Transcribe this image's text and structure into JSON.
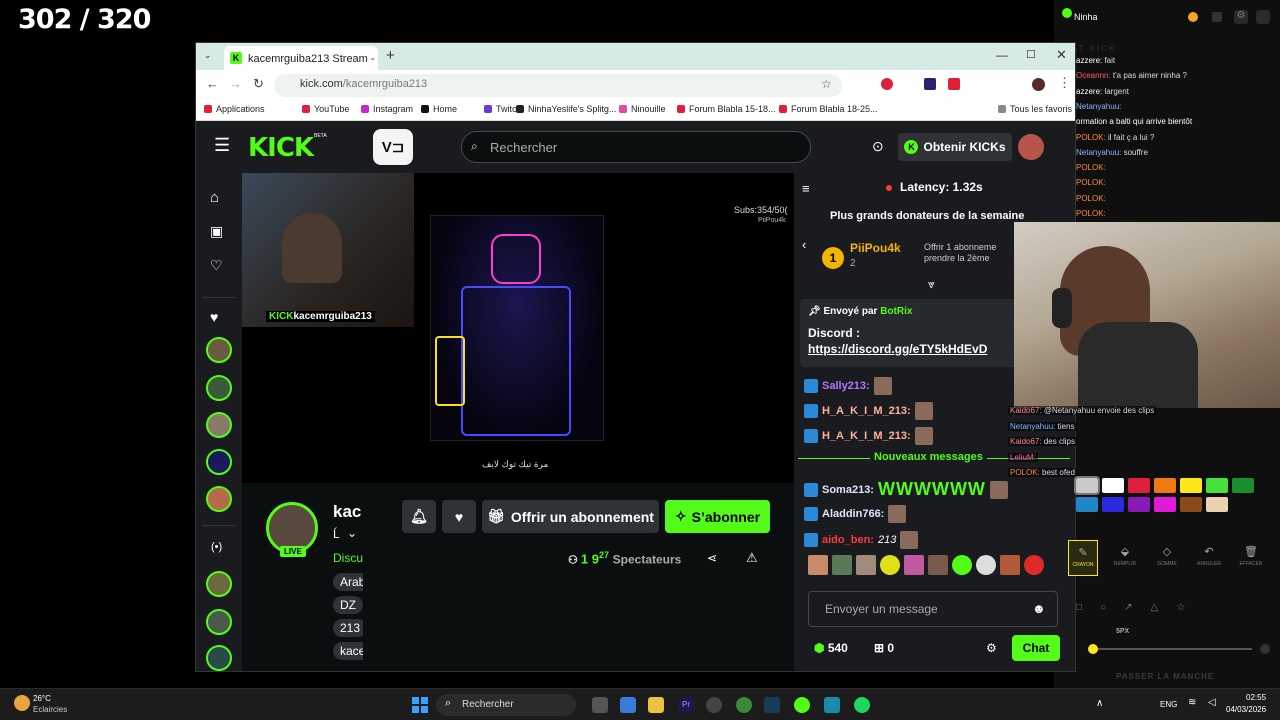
{
  "counter": "302 / 320",
  "browser": {
    "tab_title": "kacemrguiba213 Stream - ✕",
    "url_host": "kick.com",
    "url_path": "/kacemrguiba213",
    "bookmarks": [
      "Applications",
      "YouTube",
      "Instagram",
      "Home",
      "Twitch",
      "NinhaYeslife's Splitg...",
      "Ninouille",
      "Forum Blabla 15-18...",
      "Forum Blabla 18-25...",
      "Tous les favoris"
    ]
  },
  "kick": {
    "logo": "KICK",
    "beta": "BETA",
    "search_placeholder": "Rechercher",
    "get_kicks": "Obtenir KICKs",
    "streamer_short": "kac",
    "live_badge": "LIVE",
    "subtitle_glyph": "Ĺ",
    "category": "Discu",
    "tags": [
      "Arab",
      "DZ",
      "213",
      "kace"
    ],
    "gift_sub": "Offrir un abonnement",
    "subscribe": "S’abonner",
    "viewers_main": "1 9",
    "viewers_sup": "27",
    "viewers_label": "Spectateurs",
    "cam_name": "kacemrguiba213",
    "subs_overlay": "Subs:354/50(",
    "subs_user": "PiiPou4k",
    "arabic_caption": "مرة تيك توك لايف",
    "latency": "Latency: 1.32s",
    "donators_title": "Plus grands donateurs de la semaine",
    "top_donor": "PiiPou4k",
    "top_donor_count": "2",
    "gift_offer": "Offrir 1 abonneme",
    "gift_offer2": "prendre la 2ème",
    "pinned_by": "Envoyé par",
    "pinned_user": "BotRix",
    "discord_label": "Discord :",
    "discord_link": "https://discord.gg/eTY5kHdEvD",
    "messages": [
      {
        "user": "Sally213:",
        "color": "#b278ff",
        "text": ""
      },
      {
        "user": "H_A_K_I_M_213:",
        "color": "#ffb199",
        "text": ""
      },
      {
        "user": "H_A_K_I_M_213:",
        "color": "#ffb199",
        "text": ""
      }
    ],
    "new_messages": "Nouveaux messages",
    "messages2": [
      {
        "user": "Soma213:",
        "color": "#dfe5ff",
        "text": "WWWWWW"
      },
      {
        "user": "Aladdin766:",
        "color": "#dfe5ff",
        "text": ""
      },
      {
        "user": "aido_ben:",
        "color": "#ff3b3b",
        "text": "213"
      }
    ],
    "chat_placeholder": "Envoyer un message",
    "points": "540",
    "gifts": "0",
    "chat_button": "Chat"
  },
  "overlay": {
    "streamer": "Ninha",
    "header_faint": "AT KICK",
    "chat": [
      {
        "user": "azzere:",
        "text": "fait",
        "color": "#ffffff"
      },
      {
        "user": "Oceannn:",
        "text": "t'a pas aimer ninha ?",
        "color": "#ff5a5a"
      },
      {
        "user": "azzere:",
        "text": "largent",
        "color": "#ffffff"
      },
      {
        "user": "Netanyahuu:",
        "text": "",
        "color": "#8ab4ff"
      },
      {
        "user": "ormation a balti qui arrive bientôt",
        "text": "",
        "color": "#ffffff"
      },
      {
        "user": "POLOK:",
        "text": "il fait ç a lui ?",
        "color": "#ff8a3d"
      },
      {
        "user": "Netanyahuu:",
        "text": "souffre",
        "color": "#8ab4ff"
      },
      {
        "user": "POLOK:",
        "text": "",
        "color": "#ff8a3d"
      },
      {
        "user": "POLOK:",
        "text": "",
        "color": "#ff8a3d"
      },
      {
        "user": "POLOK:",
        "text": "",
        "color": "#ff8a3d"
      },
      {
        "user": "POLOK:",
        "text": "",
        "color": "#ff8a3d"
      }
    ],
    "chat2": [
      {
        "user": "Kaido67:",
        "text": "@Netanyahuu envoie des clips",
        "color": "#ff8a8a"
      },
      {
        "user": "Netanyahuu:",
        "text": "tiens",
        "color": "#8ab4ff"
      },
      {
        "user": "Kaido67:",
        "text": "des clips",
        "color": "#ff8a8a"
      },
      {
        "user": "LeliuM:",
        "text": "",
        "color": "#ff5ab4"
      },
      {
        "user": "POLOK:",
        "text": "best ofed",
        "color": "#ff8a3d"
      }
    ],
    "tool_labels": [
      "CRAYON",
      "REMPLIR",
      "GOMME",
      "ANNULER",
      "EFFACER"
    ],
    "size_label": "5PX",
    "footer_faint": "PASSER LA MANCHE",
    "swatches": [
      "#c9c9c9",
      "#ffffff",
      "#e0203a",
      "#f07a10",
      "#ffe61a",
      "#45e23b",
      "#1b8f2c",
      "#1e86c9",
      "#2a2ae0",
      "#8a1ab8",
      "#e01ad8",
      "#8a4a1a",
      "#e8d2b0"
    ]
  },
  "taskbar": {
    "weather_temp": "26°C",
    "weather_text": "Eclaircies",
    "search": "Rechercher",
    "lang": "ENG",
    "time": "02:55",
    "date": "04/03/2026"
  }
}
